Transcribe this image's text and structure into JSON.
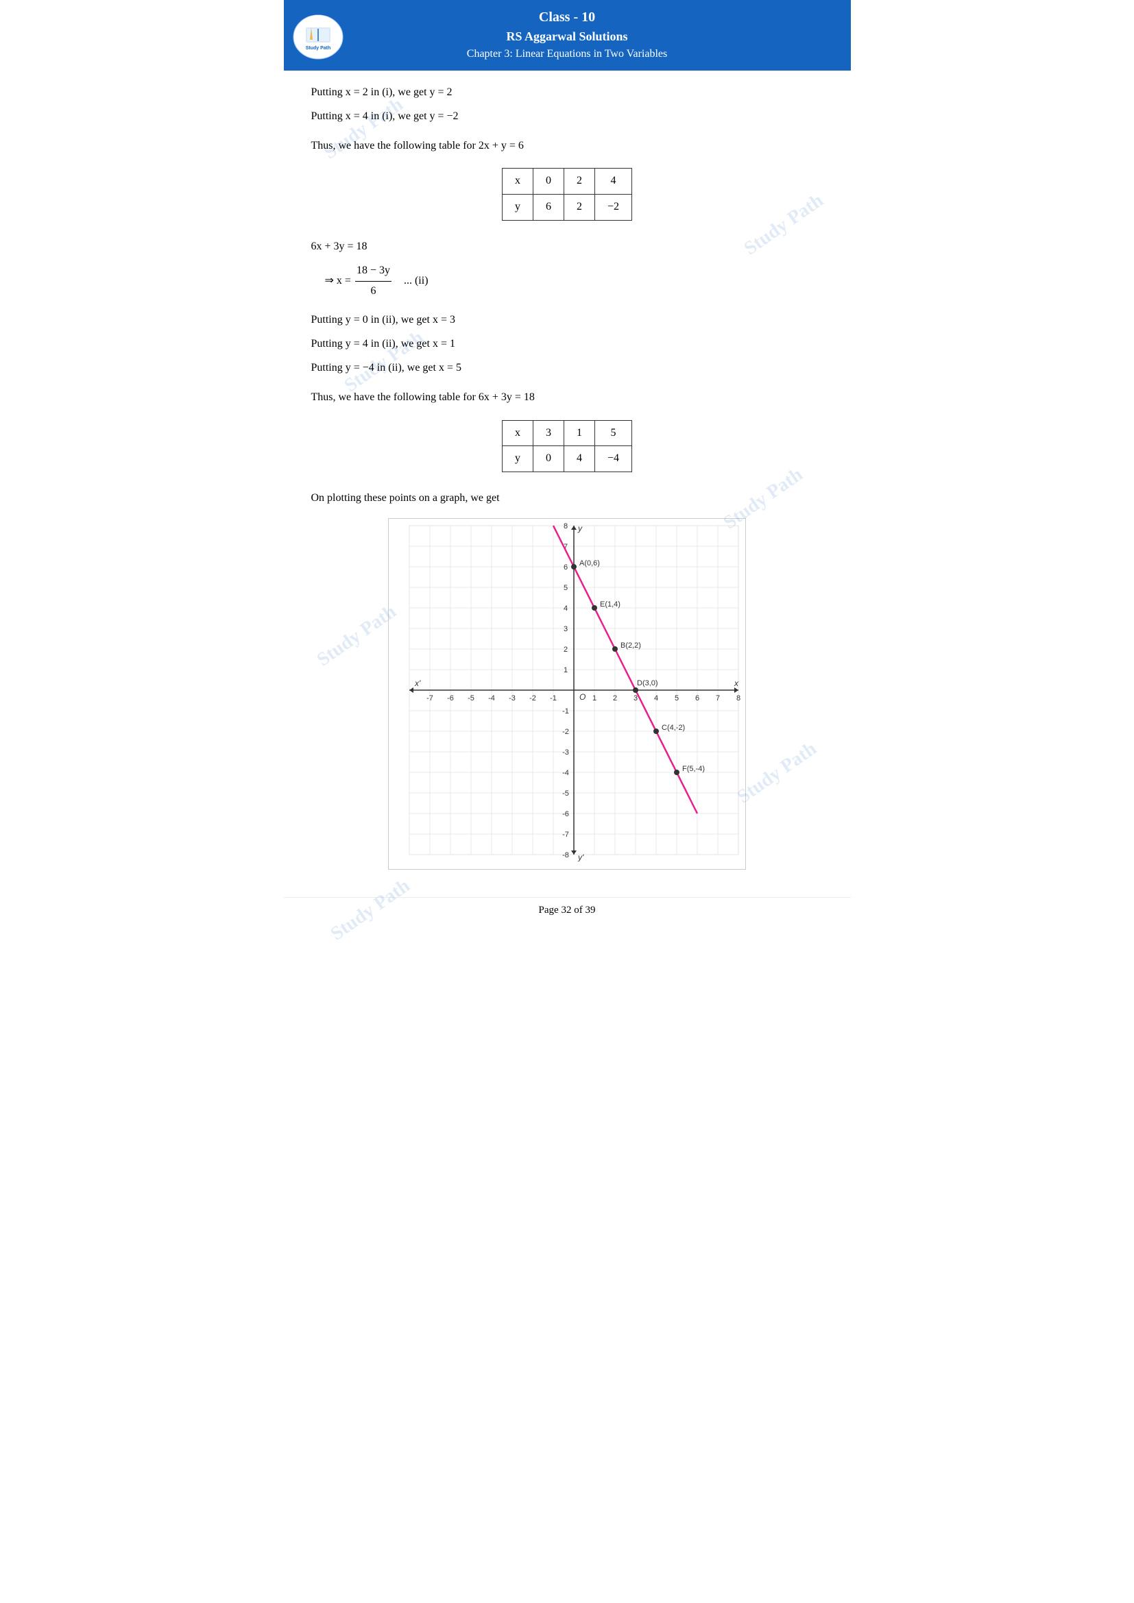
{
  "header": {
    "class_label": "Class - 10",
    "solutions_label": "RS Aggarwal Solutions",
    "chapter_label": "Chapter 3: Linear Equations in Two Variables"
  },
  "logo": {
    "text": "Study Path"
  },
  "content": {
    "putting1": "Putting x = 2 in (i), we get y = 2",
    "putting2": "Putting x = 4 in (i), we get y = −2",
    "table1_intro": "Thus, we have the following table for 2x + y = 6",
    "table1": {
      "row1": [
        "x",
        "0",
        "2",
        "4"
      ],
      "row2": [
        "y",
        "6",
        "2",
        "−2"
      ]
    },
    "eq2": "6x + 3y = 18",
    "eq2_derived": "⇒ x =",
    "eq2_numerator": "18 − 3y",
    "eq2_denominator": "6",
    "eq2_label": "... (ii)",
    "putting3": "Putting y = 0 in (ii), we get x = 3",
    "putting4": "Putting y = 4 in (ii), we get x = 1",
    "putting5": "Putting y = −4 in (ii), we get x = 5",
    "table2_intro": "Thus, we have the following table for 6x + 3y = 18",
    "table2": {
      "row1": [
        "x",
        "3",
        "1",
        "5"
      ],
      "row2": [
        "y",
        "0",
        "4",
        "−4"
      ]
    },
    "graph_intro": "On plotting these points on a graph, we get"
  },
  "graph": {
    "x_min": -7,
    "x_max": 8,
    "y_min": -8,
    "y_max": 8,
    "axis_label_x": "x",
    "axis_label_xprime": "x'",
    "axis_label_y": "y",
    "axis_label_yprime": "y'",
    "axis_label_origin": "O",
    "points": [
      {
        "label": "A(0,6)",
        "x": 0,
        "y": 6
      },
      {
        "label": "B(2,2)",
        "x": 2,
        "y": 2
      },
      {
        "label": "C(4,-2)",
        "x": 4,
        "y": -2
      },
      {
        "label": "D(3,0)",
        "x": 3,
        "y": 0
      },
      {
        "label": "E(1,4)",
        "x": 1,
        "y": 4
      },
      {
        "label": "F(5,-4)",
        "x": 5,
        "y": -4
      }
    ],
    "line1_color": "#e91e8c",
    "line2_color": "#e91e8c",
    "x_ticks": [
      -7,
      -6,
      -5,
      -4,
      -3,
      -2,
      -1,
      1,
      2,
      3,
      4,
      5,
      6,
      7,
      8
    ],
    "y_ticks": [
      -8,
      -7,
      -6,
      -5,
      -4,
      -3,
      -2,
      -1,
      1,
      2,
      3,
      4,
      5,
      6,
      7,
      8
    ]
  },
  "footer": {
    "page_text": "Page 32 of 39"
  },
  "watermarks": [
    "Study Path",
    "Study Path",
    "Study Path",
    "Study Path",
    "Study Path",
    "Study Path",
    "Study Path",
    "Study Path"
  ]
}
